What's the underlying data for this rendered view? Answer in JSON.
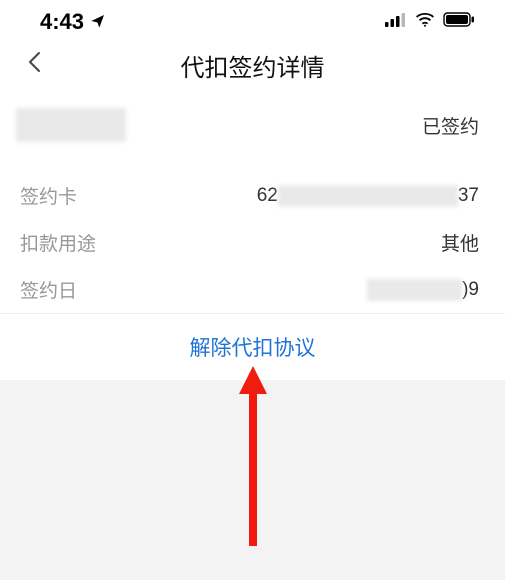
{
  "status_bar": {
    "time": "4:43"
  },
  "nav": {
    "title": "代扣签约详情"
  },
  "contract": {
    "status": "已签约",
    "card_label": "签约卡",
    "card_prefix": "62",
    "card_suffix": "37",
    "purpose_label": "扣款用途",
    "purpose_value": "其他",
    "date_label": "签约日",
    "date_suffix": ")9"
  },
  "action": {
    "cancel_label": "解除代扣协议"
  }
}
